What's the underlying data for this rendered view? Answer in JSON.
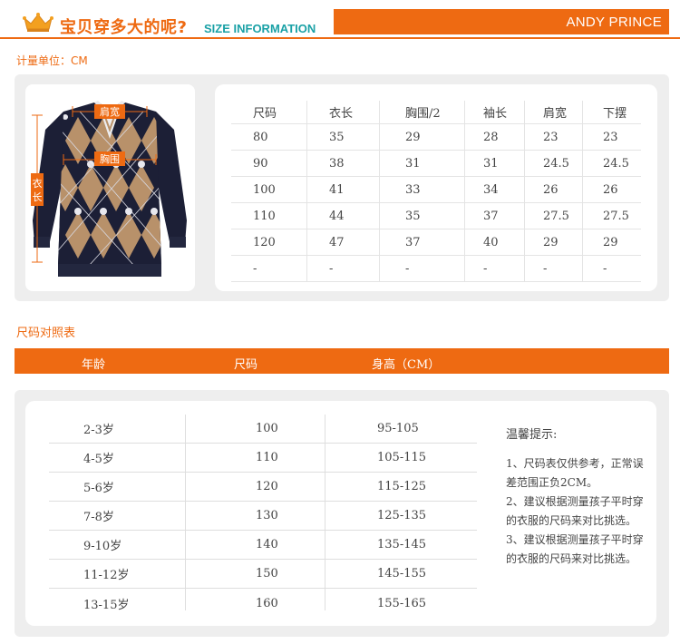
{
  "header": {
    "title_cn": "宝贝穿多大的呢?",
    "title_en": "SIZE INFORMATION",
    "brand": "ANDY PRINCE"
  },
  "measure_unit": "计量单位：CM",
  "diagram_labels": {
    "shoulder": "肩宽",
    "chest": "胸围",
    "length": "衣长"
  },
  "size_table": {
    "headers": [
      "尺码",
      "衣长",
      "胸围/2",
      "袖长",
      "肩宽",
      "下摆"
    ],
    "rows": [
      [
        "80",
        "35",
        "29",
        "28",
        "23",
        "23"
      ],
      [
        "90",
        "38",
        "31",
        "31",
        "24.5",
        "24.5"
      ],
      [
        "100",
        "41",
        "33",
        "34",
        "26",
        "26"
      ],
      [
        "110",
        "44",
        "35",
        "37",
        "27.5",
        "27.5"
      ],
      [
        "120",
        "47",
        "37",
        "40",
        "29",
        "29"
      ],
      [
        "-",
        "-",
        "-",
        "-",
        "-",
        "-"
      ]
    ]
  },
  "chart_section": {
    "label": "尺码对照表",
    "headers": [
      "年龄",
      "尺码",
      "身高（CM）"
    ],
    "rows": [
      [
        "2-3岁",
        "100",
        "95-105"
      ],
      [
        "4-5岁",
        "110",
        "105-115"
      ],
      [
        "5-6岁",
        "120",
        "115-125"
      ],
      [
        "7-8岁",
        "130",
        "125-135"
      ],
      [
        "9-10岁",
        "140",
        "135-145"
      ],
      [
        "11-12岁",
        "150",
        "145-155"
      ],
      [
        "13-15岁",
        "160",
        "155-165"
      ]
    ]
  },
  "tips": {
    "title": "温馨提示:",
    "items": [
      "1、尺码表仅供参考，正常误差范围正负2CM。",
      "2、建议根据测量孩子平时穿的衣服的尺码来对比挑选。",
      "3、建议根据测量孩子平时穿的衣服的尺码来对比挑选。"
    ]
  },
  "colors": {
    "accent": "#ee6a12",
    "teal": "#1aa1a6",
    "sweater_navy": "#1c1f36",
    "sweater_tan": "#b8916a"
  }
}
